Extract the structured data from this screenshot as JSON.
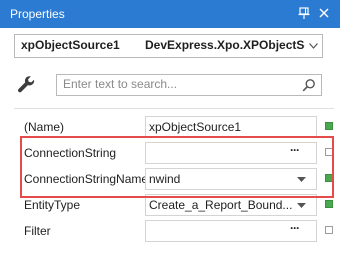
{
  "titlebar": {
    "title": "Properties",
    "icons": [
      "pin-icon",
      "close-icon"
    ],
    "background": "#2b7bd3"
  },
  "selector": {
    "object_name": "xpObjectSource1",
    "object_type": "DevExpress.Xpo.XPObjectSo..."
  },
  "search": {
    "placeholder": "Enter text to search...",
    "value": ""
  },
  "properties": [
    {
      "name": "(Name)",
      "value": "xpObjectSource1",
      "editor": "text",
      "modified": true
    },
    {
      "name": "ConnectionString",
      "value": "",
      "editor": "ellipsis",
      "modified": false
    },
    {
      "name": "ConnectionStringName",
      "value": "nwind",
      "editor": "dropdown",
      "modified": true
    },
    {
      "name": "EntityType",
      "value": "Create_a_Report_Bound...",
      "editor": "dropdown",
      "modified": true
    },
    {
      "name": "Filter",
      "value": "",
      "editor": "ellipsis",
      "modified": false
    }
  ],
  "colors": {
    "highlight_border": "#e44b4b",
    "modified_marker": "#4aa84f"
  }
}
